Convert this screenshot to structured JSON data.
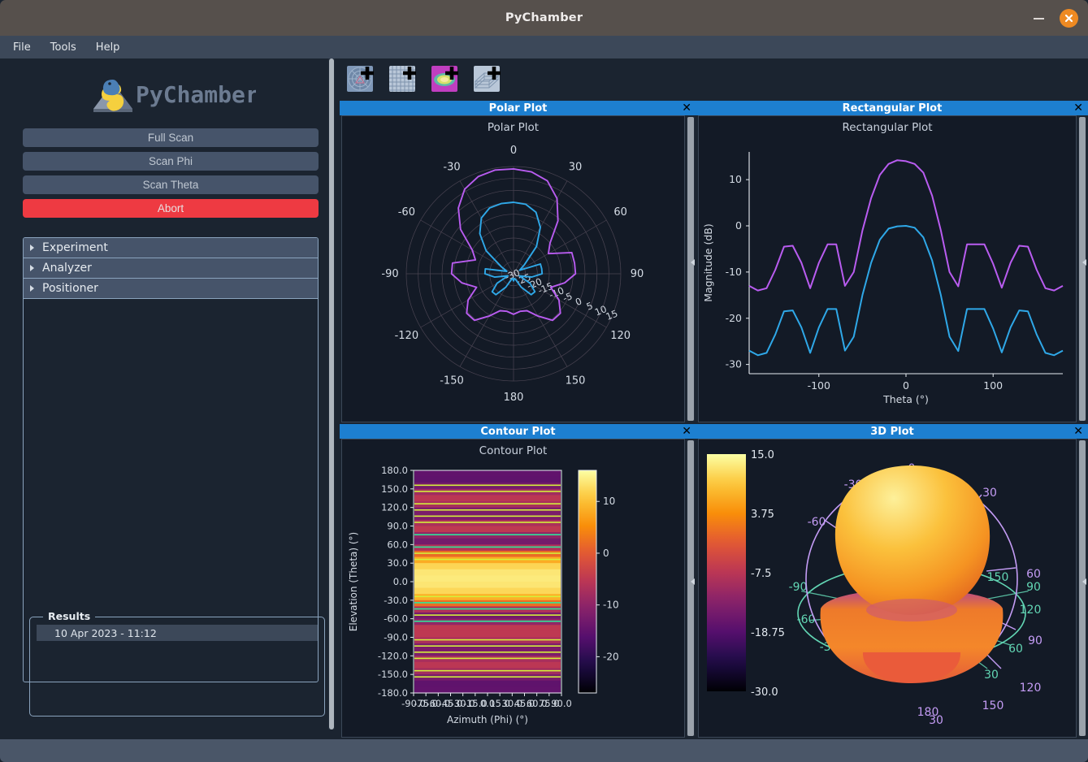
{
  "window": {
    "title": "PyChamber",
    "minimize_label": "–",
    "close_label": "✕"
  },
  "menubar": {
    "items": [
      "File",
      "Tools",
      "Help"
    ]
  },
  "sidebar": {
    "logo_text": "PyChamber",
    "scan_buttons": [
      {
        "label": "Full Scan",
        "name": "full-scan-button"
      },
      {
        "label": "Scan Phi",
        "name": "scan-phi-button"
      },
      {
        "label": "Scan Theta",
        "name": "scan-theta-button"
      },
      {
        "label": "Abort",
        "name": "abort-button"
      }
    ],
    "collapsible_sections": [
      "Experiment",
      "Analyzer",
      "Positioner"
    ],
    "results": {
      "legend": "Results",
      "items": [
        "10 Apr 2023 - 11:12"
      ]
    }
  },
  "toolbar": {
    "buttons": [
      {
        "name": "add-polar-plot-button",
        "icon": "polar-plot-add-icon"
      },
      {
        "name": "add-rectangular-plot-button",
        "icon": "rectangular-plot-add-icon"
      },
      {
        "name": "add-contour-plot-button",
        "icon": "contour-plot-add-icon"
      },
      {
        "name": "add-3d-plot-button",
        "icon": "three-d-plot-add-icon"
      }
    ]
  },
  "panels": [
    {
      "title": "Polar Plot",
      "close": "✕"
    },
    {
      "title": "Rectangular Plot",
      "close": "✕"
    },
    {
      "title": "Contour Plot",
      "close": "✕"
    },
    {
      "title": "3D Plot",
      "close": "✕"
    }
  ],
  "colors": {
    "accent_blue": "#1d7fd0",
    "abort_red": "#ee3a42",
    "trace_magenta": "#b95cf0",
    "trace_cyan": "#2fa8e8",
    "window_chrome": "#56504c",
    "panel_bg": "#131a26",
    "sidebar_bg": "#1b2430",
    "button_slate": "#46546a",
    "status_bar": "#4a5668"
  },
  "chart_data": [
    {
      "type": "line",
      "plot_name": "polar-plot",
      "title": "Polar Plot",
      "coordinate_system": "polar",
      "angular_ticks": [
        0,
        30,
        60,
        90,
        120,
        150,
        180,
        -150,
        -120,
        -90,
        -60,
        -30
      ],
      "angular_tick_labels": [
        "0",
        "30",
        "60",
        "90",
        "120",
        "150",
        "180",
        "-150",
        "-120",
        "-90",
        "-60",
        "-30"
      ],
      "radial_ticks": [
        -30,
        -25,
        -20,
        -15,
        -10,
        -5,
        0,
        5,
        10,
        15
      ],
      "radial_tick_labels": [
        "-30",
        "-25",
        "-20",
        "-15",
        "-10",
        "-5",
        "0",
        "5",
        "10",
        "15"
      ],
      "rlim": [
        -30,
        15
      ],
      "grid": true,
      "legend": null,
      "series": [
        {
          "name": "trace-magenta",
          "color": "#b95cf0",
          "theta": [
            -180,
            -170,
            -160,
            -150,
            -140,
            -130,
            -120,
            -110,
            -100,
            -90,
            -80,
            -70,
            -60,
            -50,
            -40,
            -30,
            -20,
            -10,
            0,
            10,
            20,
            30,
            40,
            50,
            60,
            70,
            80,
            90,
            100,
            110,
            120,
            130,
            140,
            150,
            160,
            170,
            180
          ],
          "values": [
            -13,
            -14,
            -13.5,
            -9.5,
            -4.5,
            -4.3,
            -8,
            -13.5,
            -8,
            -4,
            -4,
            -13,
            -10,
            -1,
            6,
            11,
            13.4,
            14.2,
            14,
            13.4,
            11.5,
            6.5,
            -1,
            -10,
            -13.1,
            -4,
            -4,
            -4,
            -8.2,
            -13.4,
            -8,
            -4.3,
            -4.5,
            -9.5,
            -13.5,
            -14,
            -13
          ]
        },
        {
          "name": "trace-cyan",
          "color": "#2fa8e8",
          "theta": [
            -180,
            -170,
            -160,
            -150,
            -140,
            -130,
            -120,
            -110,
            -100,
            -90,
            -80,
            -70,
            -60,
            -50,
            -40,
            -30,
            -20,
            -10,
            0,
            10,
            20,
            30,
            40,
            50,
            60,
            70,
            80,
            90,
            100,
            110,
            120,
            130,
            140,
            150,
            160,
            170,
            180
          ],
          "values": [
            -27,
            -28,
            -27.5,
            -23.5,
            -18.5,
            -18.3,
            -22,
            -27.5,
            -22,
            -18,
            -18,
            -27,
            -24,
            -15,
            -8,
            -3,
            -0.6,
            -0.1,
            0,
            -0.4,
            -2.5,
            -7.5,
            -15,
            -24,
            -27.1,
            -18,
            -18,
            -18,
            -22.2,
            -27.4,
            -22,
            -18.3,
            -18.5,
            -23.5,
            -27.5,
            -28,
            -27
          ]
        }
      ]
    },
    {
      "type": "line",
      "plot_name": "rectangular-plot",
      "title": "Rectangular Plot",
      "xlabel": "Theta (°)",
      "ylabel": "Magnitude (dB)",
      "xticks": [
        -100,
        0,
        100
      ],
      "xtick_labels": [
        "-100",
        "0",
        "100"
      ],
      "yticks": [
        -30,
        -20,
        -10,
        0,
        10
      ],
      "ytick_labels": [
        "-30",
        "-20",
        "-10",
        "0",
        "10"
      ],
      "xlim": [
        -180,
        180
      ],
      "ylim": [
        -32,
        16
      ],
      "grid": false,
      "legend": null,
      "x": [
        -180,
        -170,
        -160,
        -150,
        -140,
        -130,
        -120,
        -110,
        -100,
        -90,
        -80,
        -70,
        -60,
        -50,
        -40,
        -30,
        -20,
        -10,
        0,
        10,
        20,
        30,
        40,
        50,
        60,
        70,
        80,
        90,
        100,
        110,
        120,
        130,
        140,
        150,
        160,
        170,
        180
      ],
      "series": [
        {
          "name": "trace-magenta",
          "color": "#b95cf0",
          "values": [
            -13,
            -14,
            -13.5,
            -9.5,
            -4.5,
            -4.3,
            -8,
            -13.5,
            -8,
            -4,
            -4,
            -13,
            -10,
            -1,
            6,
            11,
            13.4,
            14.2,
            14,
            13.4,
            11.5,
            6.5,
            -1,
            -10,
            -13.1,
            -4,
            -4,
            -4,
            -8.2,
            -13.4,
            -8,
            -4.3,
            -4.5,
            -9.5,
            -13.5,
            -14,
            -13
          ]
        },
        {
          "name": "trace-cyan",
          "color": "#2fa8e8",
          "values": [
            -27,
            -28,
            -27.5,
            -23.5,
            -18.5,
            -18.3,
            -22,
            -27.5,
            -22,
            -18,
            -18,
            -27,
            -24,
            -15,
            -8,
            -3,
            -0.6,
            -0.1,
            0,
            -0.4,
            -2.5,
            -7.5,
            -15,
            -24,
            -27.1,
            -18,
            -18,
            -18,
            -22.2,
            -27.4,
            -22,
            -18.3,
            -18.5,
            -23.5,
            -27.5,
            -28,
            -27
          ]
        }
      ]
    },
    {
      "type": "heatmap",
      "plot_name": "contour-plot",
      "title": "Contour Plot",
      "xlabel": "Azimuth (Phi) (°)",
      "ylabel": "Elevation (Theta) (°)",
      "xticks": [
        -90.0,
        -75.0,
        -60.0,
        -45.0,
        -30.0,
        -15.0,
        0.0,
        15.0,
        30.0,
        45.0,
        60.0,
        75.0,
        90.0
      ],
      "xtick_labels": [
        "-90.0",
        "-75.0",
        "-60.0",
        "-45.0",
        "-30.0",
        "-15.0",
        "0.0",
        "15.0",
        "30.0",
        "45.0",
        "60.0",
        "75.0",
        "90.0"
      ],
      "yticks": [
        180.0,
        150.0,
        120.0,
        90.0,
        60.0,
        30.0,
        0.0,
        -30.0,
        -60.0,
        -90.0,
        -120.0,
        -150.0,
        -180.0
      ],
      "ytick_labels": [
        "180.0",
        "150.0",
        "120.0",
        "90.0",
        "60.0",
        "30.0",
        "0.0",
        "-30.0",
        "-60.0",
        "-90.0",
        "-120.0",
        "-150.0",
        "-180.0"
      ],
      "colorbar_ticks": [
        10,
        0,
        -10,
        -20
      ],
      "colorbar_tick_labels": [
        "10",
        "0",
        "-10",
        "-20"
      ],
      "colormap": "inferno",
      "row_theta": [
        180,
        170,
        160,
        150,
        140,
        130,
        120,
        110,
        100,
        90,
        80,
        70,
        60,
        50,
        40,
        30,
        20,
        10,
        0,
        -10,
        -20,
        -30,
        -40,
        -50,
        -60,
        -70,
        -80,
        -90,
        -100,
        -110,
        -120,
        -130,
        -140,
        -150,
        -160,
        -170,
        -180
      ],
      "row_values": [
        -13,
        -14,
        -13.5,
        -9.5,
        -4.5,
        -4.3,
        -8,
        -13.5,
        -8,
        -4,
        -4,
        -13,
        -10,
        -1,
        6,
        11,
        13.4,
        14.2,
        14,
        13.4,
        11.5,
        6.5,
        -1,
        -10,
        -13.1,
        -4,
        -4,
        -4,
        -8.2,
        -13.4,
        -8,
        -4.3,
        -4.5,
        -9.5,
        -13.5,
        -14,
        -13
      ]
    },
    {
      "type": "surface",
      "plot_name": "three-d-plot",
      "title": "3D Plot",
      "colorbar_ticks": [
        15.0,
        3.75,
        -7.5,
        -18.75,
        -30.0
      ],
      "colorbar_tick_labels": [
        "15.0",
        "3.75",
        "-7.5",
        "-18.75",
        "-30.0"
      ],
      "colormap": "inferno",
      "theta_ring_labels": [
        "0",
        "-30",
        "-60",
        "-90",
        "30",
        "60",
        "90",
        "120",
        "150",
        "180",
        "30",
        "60",
        "120",
        "150"
      ],
      "phi_ring_labels": [
        "-60",
        "-30",
        "0",
        "30",
        "60",
        "90",
        "120",
        "150"
      ],
      "theta_ring_color": "#c49cf5",
      "phi_ring_color": "#62d6b4"
    }
  ]
}
